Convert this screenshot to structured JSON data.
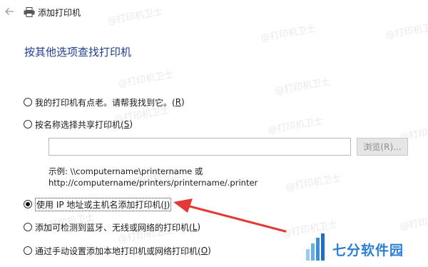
{
  "window": {
    "title": "添加打印机"
  },
  "heading": "按其他选项查找打印机",
  "options": [
    {
      "label": "我的打印机有点老。请帮我找到它。(",
      "key": "R",
      "suffix": ")",
      "checked": false
    },
    {
      "label": "按名称选择共享打印机(",
      "key": "S",
      "suffix": ")",
      "checked": false
    },
    {
      "label": "使用 IP 地址或主机名添加打印机(",
      "key": "I",
      "suffix": ")",
      "checked": true
    },
    {
      "label": "添加可检测到蓝牙、无线或网络的打印机(",
      "key": "L",
      "suffix": ")",
      "checked": false
    },
    {
      "label": "通过手动设置添加本地打印机或网络打印机(",
      "key": "O",
      "suffix": ")",
      "checked": false
    }
  ],
  "share_input": {
    "value": ""
  },
  "browse_button": "浏览(R)...",
  "example_line1": "示例: \\\\computername\\printername 或",
  "example_line2": "http://computername/printers/printername/.printer",
  "watermarks": [
    "@打印机卫士",
    "@打印机卫士",
    "@打印机卫士",
    "@打印机卫士",
    "@打印机卫士",
    "@打印机卫士",
    "@打印机卫士",
    "@打印机卫士",
    "@打印机卫士",
    "@打印机卫士",
    "@打印机卫士",
    "@打印机卫士",
    "@打印机卫士",
    "@打印机卫士"
  ],
  "brand": {
    "logo_text": "七分软件园",
    "color": "#2a7fd4"
  },
  "annotation_arrow": {
    "color": "#e53935"
  },
  "icons": {
    "back": "back-arrow-icon",
    "printer": "printer-icon",
    "logo": "qifen-logo-icon"
  }
}
